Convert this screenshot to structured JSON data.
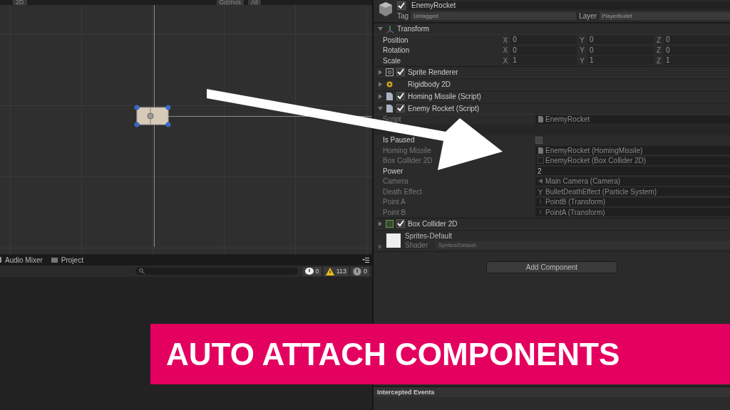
{
  "scene_toolbar": {
    "items": [
      "2D",
      "Gizmos",
      "All"
    ]
  },
  "bottom_panel": {
    "tabs": [
      {
        "label": "Audio Mixer",
        "kind": "mixer"
      },
      {
        "label": "Project",
        "kind": "folder"
      }
    ],
    "counts": [
      {
        "kind": "info",
        "count": "0"
      },
      {
        "kind": "warning",
        "count": "113"
      },
      {
        "kind": "error",
        "count": "0"
      }
    ]
  },
  "inspector": {
    "object": {
      "name": "EnemyRocket",
      "active": true,
      "tag_label": "Tag",
      "tag": "Untagged",
      "layer_label": "Layer",
      "layer": "PlayerBullet"
    },
    "transform": {
      "title": "Transform",
      "expanded": true,
      "rows": [
        {
          "label": "Position",
          "values": [
            {
              "axis": "X",
              "value": "0"
            },
            {
              "axis": "Y",
              "value": "0"
            },
            {
              "axis": "Z",
              "value": "0"
            }
          ]
        },
        {
          "label": "Rotation",
          "values": [
            {
              "axis": "X",
              "value": "0"
            },
            {
              "axis": "Y",
              "value": "0"
            },
            {
              "axis": "Z",
              "value": "0"
            }
          ]
        },
        {
          "label": "Scale",
          "values": [
            {
              "axis": "X",
              "value": "1"
            },
            {
              "axis": "Y",
              "value": "1"
            },
            {
              "axis": "Z",
              "value": "1"
            }
          ]
        }
      ]
    },
    "components": [
      {
        "title": "Sprite Renderer",
        "kind": "sprite",
        "enabled": true,
        "expanded": false
      },
      {
        "title": "Rigidbody 2D",
        "kind": "rigidbody",
        "expanded": false
      },
      {
        "title": "Homing Missile (Script)",
        "kind": "script",
        "enabled": true,
        "expanded": false
      },
      {
        "title": "Enemy Rocket (Script)",
        "kind": "script",
        "enabled": true,
        "expanded": true,
        "properties": [
          {
            "label": "Script",
            "kind": "script",
            "value": "EnemyRocket",
            "disabled": true
          },
          {
            "kind": "header"
          },
          {
            "label": "Is Paused",
            "kind": "checkbox",
            "checked": false,
            "disabled": false
          },
          {
            "label": "Homing Missile",
            "kind": "script",
            "value": "EnemyRocket (HomingMissile)",
            "disabled": true
          },
          {
            "label": "Box Collider 2D",
            "kind": "collider",
            "value": "EnemyRocket (Box Collider 2D)",
            "disabled": true
          },
          {
            "label": "Power",
            "kind": "text",
            "value": "2",
            "disabled": false
          },
          {
            "label": "Camera",
            "kind": "camera",
            "value": "Main Camera (Camera)",
            "disabled": true
          },
          {
            "label": "Death Effect",
            "kind": "particles",
            "value": "BulletDeathEffect (Particle System)",
            "disabled": true
          },
          {
            "label": "Point A",
            "kind": "transform",
            "value": "PointB (Transform)",
            "disabled": true
          },
          {
            "label": "Point B",
            "kind": "transform",
            "value": "PointA (Transform)",
            "disabled": true
          }
        ]
      },
      {
        "title": "Box Collider 2D",
        "kind": "collider",
        "enabled": true,
        "expanded": false
      }
    ],
    "material": {
      "name": "Sprites-Default",
      "shader_label": "Shader",
      "shader": "Sprites/Default"
    },
    "add_button": "Add Component"
  },
  "events_panel": {
    "title": "Intercepted Events"
  },
  "banner": {
    "text": "AUTO ATTACH COMPONENTS"
  }
}
